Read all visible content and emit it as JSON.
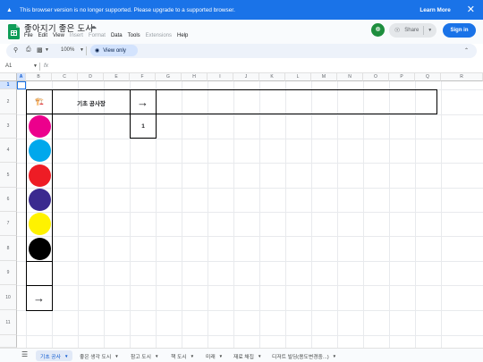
{
  "banner": {
    "message": "This browser version is no longer supported. Please upgrade to a supported browser.",
    "learn_more": "Learn More",
    "warning_icon": "warning-icon",
    "close_icon": "close-icon"
  },
  "doc": {
    "title": "좋아지기 좋은 도시",
    "menus": [
      "File",
      "Edit",
      "View",
      "Insert",
      "Format",
      "Data",
      "Tools",
      "Extensions",
      "Help"
    ],
    "disabled_menus": [
      "Insert",
      "Format",
      "Extensions"
    ]
  },
  "header": {
    "share_label": "Share",
    "signin_label": "Sign in",
    "avatar_letter": "⚑",
    "brand_color": "#1a73e8"
  },
  "toolbar": {
    "zoom": "100%",
    "view_only": "View only"
  },
  "formula_bar": {
    "cell_ref": "A1",
    "fx": "fx"
  },
  "grid": {
    "columns": [
      "A",
      "B",
      "C",
      "D",
      "E",
      "F",
      "G",
      "H",
      "I",
      "J",
      "K",
      "L",
      "M",
      "N",
      "O",
      "P",
      "Q",
      "R"
    ],
    "rows": [
      "1",
      "2",
      "3",
      "4",
      "5",
      "6",
      "7",
      "8",
      "9",
      "10",
      "11"
    ],
    "selected_column": "A",
    "selected_row": "1"
  },
  "sheet": {
    "icon_b2": "🏗️",
    "c2_label": "기초 공사장",
    "f2_arrow": "→",
    "f3_value": "1",
    "b10_arrow": "→",
    "circle_colors": [
      "#ec008c",
      "#00a8ec",
      "#ee1c25",
      "#3b2a8f",
      "#fff200",
      "#000000"
    ]
  },
  "tabs": [
    {
      "label": "기초 공사",
      "active": true
    },
    {
      "label": "좋은 생각 도시",
      "active": false
    },
    {
      "label": "참고 도시",
      "active": false
    },
    {
      "label": "책 도시",
      "active": false
    },
    {
      "label": "미래",
      "active": false
    },
    {
      "label": "재료 채집",
      "active": false
    },
    {
      "label": "디저트 빌딩(용도변경중...)",
      "active": false
    }
  ]
}
